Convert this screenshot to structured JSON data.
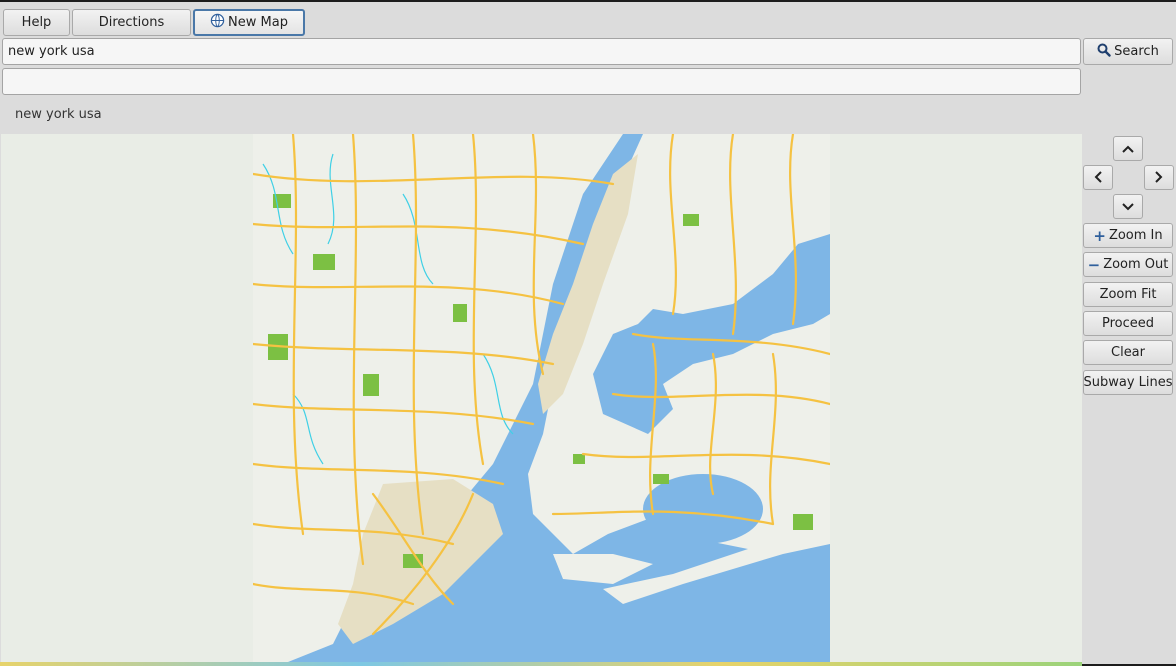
{
  "toolbar": {
    "help_label": "Help",
    "directions_label": "Directions",
    "new_map_label": "New Map"
  },
  "search": {
    "value": "new york usa",
    "button_label": "Search"
  },
  "second_input": {
    "value": ""
  },
  "status_text": "new york usa",
  "controls": {
    "up_icon": "chevron-up-icon",
    "left_icon": "chevron-left-icon",
    "right_icon": "chevron-right-icon",
    "down_icon": "chevron-down-icon",
    "zoom_in_label": "Zoom In",
    "zoom_out_label": "Zoom Out",
    "zoom_fit_label": "Zoom Fit",
    "proceed_label": "Proceed",
    "clear_label": "Clear",
    "subway_lines_label": "Subway Lines"
  },
  "colors": {
    "window_bg": "#dcdcdc",
    "map_background": "#e9ede6",
    "water": "#7eb6e6",
    "land": "#eef0ea",
    "roads": "#f5c242",
    "parks": "#7cc043",
    "streams": "#3fd0e6",
    "urban": "#e6dfc4",
    "accent": "#2f5f9c"
  }
}
